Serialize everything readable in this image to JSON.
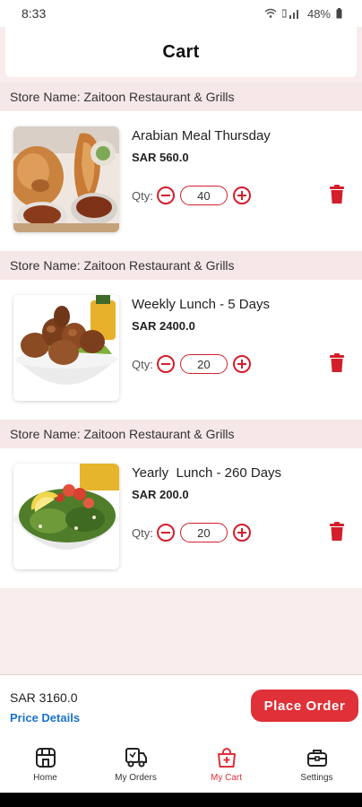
{
  "status": {
    "time": "8:33",
    "battery": "48%"
  },
  "header": {
    "title": "Cart"
  },
  "items": [
    {
      "store_label": "Store Name: Zaitoon Restaurant & Grills",
      "name": "Arabian Meal Thursday",
      "price": "SAR 560.0",
      "qty_label": "Qty:",
      "qty": "40"
    },
    {
      "store_label": "Store Name: Zaitoon Restaurant & Grills",
      "name": "Weekly Lunch - 5 Days",
      "price": "SAR 2400.0",
      "qty_label": "Qty:",
      "qty": "20"
    },
    {
      "store_label": "Store Name: Zaitoon Restaurant & Grills",
      "name": "Yearly  Lunch - 260 Days",
      "price": "SAR 200.0",
      "qty_label": "Qty:",
      "qty": "20"
    }
  ],
  "footer": {
    "total": "SAR 3160.0",
    "price_details": "Price Details",
    "place_order": "Place Order"
  },
  "nav": [
    {
      "label": "Home",
      "icon": "store-icon"
    },
    {
      "label": "My Orders",
      "icon": "delivery-truck-icon"
    },
    {
      "label": "My Cart",
      "icon": "shopping-bag-icon"
    },
    {
      "label": "Settings",
      "icon": "briefcase-icon"
    }
  ],
  "colors": {
    "accent": "#e03038",
    "link": "#1a73c8",
    "background": "#f8eced"
  }
}
